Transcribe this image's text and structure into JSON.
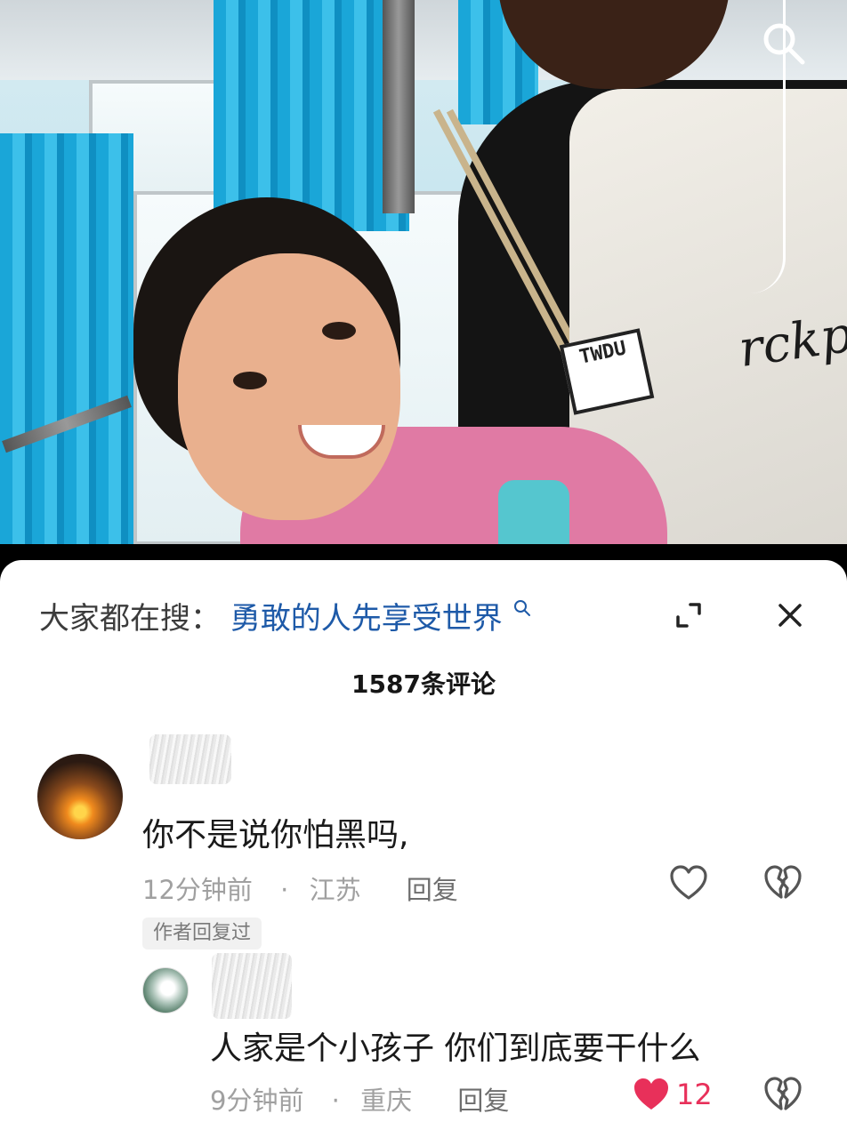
{
  "hot_search": {
    "label": "大家都在搜：",
    "term": "勇敢的人先享受世界"
  },
  "comments_count": "1587条评论",
  "comments": [
    {
      "text": "你不是说你怕黑吗,",
      "time": "12分钟前",
      "location": "江苏",
      "reply_label": "回复",
      "badge": "作者回复过",
      "liked": false
    }
  ],
  "replies": [
    {
      "text": "人家是个小孩子 你们到底要干什么",
      "time": "9分钟前",
      "location": "重庆",
      "reply_label": "回复",
      "likes": "12",
      "liked": true
    }
  ],
  "meta_separator": "·",
  "photo": {
    "badge_text": "TWDU",
    "shirt_text": "rckpo"
  },
  "colors": {
    "hot_term": "#1e5aa8",
    "liked_heart": "#e8305a",
    "meta_text": "#a0a0a0"
  },
  "icons": {
    "search": "search-icon",
    "expand": "expand-icon",
    "close": "close-icon",
    "like": "heart-icon",
    "dislike": "broken-heart-icon"
  }
}
